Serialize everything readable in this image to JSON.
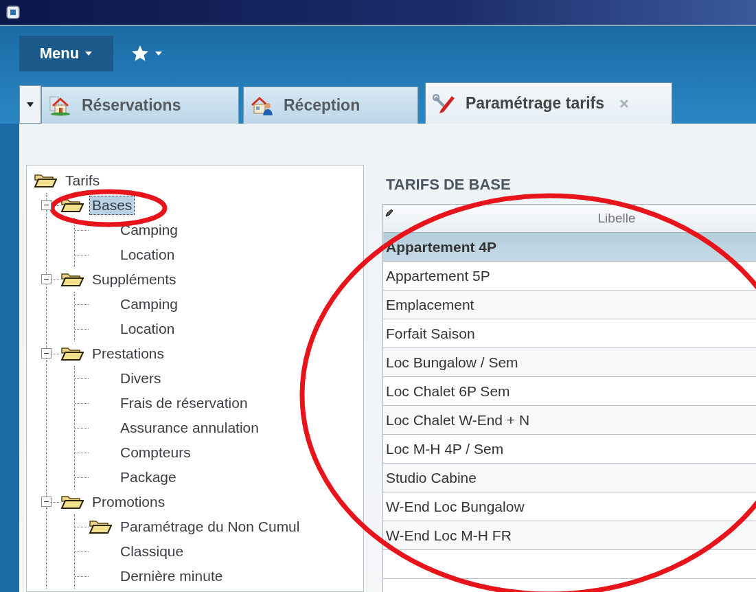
{
  "toolbar": {
    "menu": "Menu"
  },
  "tabs": [
    {
      "label": "Réservations",
      "selected": false
    },
    {
      "label": "Réception",
      "selected": false
    },
    {
      "label": "Paramétrage tarifs",
      "selected": true
    }
  ],
  "tree": [
    {
      "label": "Tarifs",
      "kind": "folder",
      "selected": false,
      "children": [
        {
          "label": "Bases",
          "kind": "folder",
          "expanded": true,
          "selected": true,
          "children": [
            {
              "label": "Camping",
              "kind": "leaf",
              "selected": false
            },
            {
              "label": "Location",
              "kind": "leaf",
              "selected": false
            }
          ]
        },
        {
          "label": "Suppléments",
          "kind": "folder",
          "expanded": true,
          "selected": false,
          "children": [
            {
              "label": "Camping",
              "kind": "leaf",
              "selected": false
            },
            {
              "label": "Location",
              "kind": "leaf",
              "selected": false
            }
          ]
        },
        {
          "label": "Prestations",
          "kind": "folder",
          "expanded": true,
          "selected": false,
          "children": [
            {
              "label": "Divers",
              "kind": "leaf",
              "selected": false
            },
            {
              "label": "Frais de réservation",
              "kind": "leaf",
              "selected": false
            },
            {
              "label": "Assurance annulation",
              "kind": "leaf",
              "selected": false
            },
            {
              "label": "Compteurs",
              "kind": "leaf",
              "selected": false
            },
            {
              "label": "Package",
              "kind": "leaf",
              "selected": false
            }
          ]
        },
        {
          "label": "Promotions",
          "kind": "folder",
          "expanded": true,
          "selected": false,
          "children": [
            {
              "label": "Paramétrage du Non Cumul",
              "kind": "folder",
              "selected": false
            },
            {
              "label": "Classique",
              "kind": "leaf",
              "selected": false
            },
            {
              "label": "Dernière minute",
              "kind": "leaf",
              "selected": false
            }
          ]
        }
      ]
    }
  ],
  "section_title": "TARIFS DE BASE",
  "table": {
    "columns": [
      "Libelle"
    ],
    "rows": [
      {
        "libelle": "Appartement 4P",
        "selected": true
      },
      {
        "libelle": "Appartement 5P",
        "selected": false
      },
      {
        "libelle": "Emplacement",
        "selected": false
      },
      {
        "libelle": "Forfait Saison",
        "selected": false
      },
      {
        "libelle": "Loc Bungalow / Sem",
        "selected": false
      },
      {
        "libelle": "Loc Chalet 6P Sem",
        "selected": false
      },
      {
        "libelle": "Loc Chalet W-End + N",
        "selected": false
      },
      {
        "libelle": "Loc M-H 4P / Sem",
        "selected": false
      },
      {
        "libelle": "Studio Cabine",
        "selected": false
      },
      {
        "libelle": "W-End Loc Bungalow",
        "selected": false
      },
      {
        "libelle": "W-End Loc M-H FR",
        "selected": false
      }
    ]
  }
}
